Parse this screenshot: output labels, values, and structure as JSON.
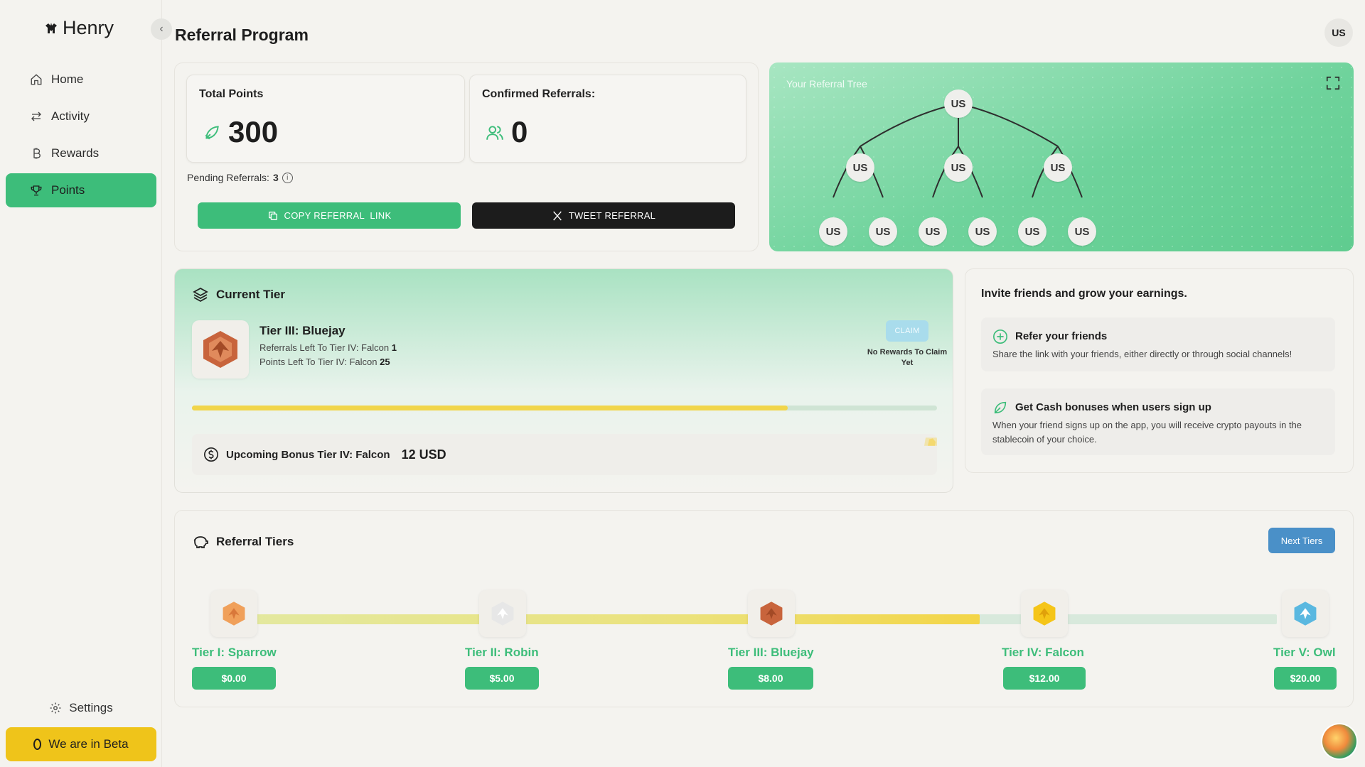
{
  "brand": {
    "name": "Henry"
  },
  "nav": {
    "items": [
      {
        "label": "Home",
        "icon": "home-icon"
      },
      {
        "label": "Activity",
        "icon": "activity-icon"
      },
      {
        "label": "Rewards",
        "icon": "bitcoin-icon"
      },
      {
        "label": "Points",
        "icon": "trophy-icon",
        "active": true
      }
    ],
    "settings_label": "Settings",
    "beta_label": "We are in Beta"
  },
  "header": {
    "title": "Referral Program",
    "user_initials": "US"
  },
  "stats": {
    "total_points_label": "Total Points",
    "total_points_value": "300",
    "confirmed_label": "Confirmed Referrals:",
    "confirmed_value": "0",
    "pending_label": "Pending Referrals:",
    "pending_value": "3",
    "copy_button": "COPY REFERRAL  LINK",
    "tweet_button": "TWEET REFERRAL"
  },
  "tree": {
    "label": "Your Referral Tree",
    "root": "US",
    "level1": [
      "US",
      "US",
      "US"
    ],
    "level2": [
      "US",
      "US",
      "US",
      "US",
      "US",
      "US"
    ]
  },
  "current_tier": {
    "heading": "Current Tier",
    "name": "Tier III: Bluejay",
    "referrals_left_label": "Referrals Left To Tier IV: Falcon",
    "referrals_left_value": "1",
    "points_left_label": "Points Left To Tier IV: Falcon",
    "points_left_value": "25",
    "claim_label": "CLAIM",
    "no_rewards": "No Rewards To Claim Yet",
    "progress_fraction": 0.8,
    "bonus_label": "Upcoming Bonus Tier IV: Falcon",
    "bonus_value": "12 USD"
  },
  "invite": {
    "title": "Invite friends and grow your earnings.",
    "cards": [
      {
        "heading": "Refer your friends",
        "desc": "Share the link with your friends, either directly or through social channels!"
      },
      {
        "heading": "Get Cash bonuses when users sign up",
        "desc": "When your friend signs up on the app, you will receive crypto payouts in the stablecoin of your choice."
      }
    ]
  },
  "referral_tiers": {
    "heading": "Referral Tiers",
    "next_button": "Next Tiers",
    "tiers": [
      {
        "name": "Tier I: Sparrow",
        "price": "$0.00",
        "color": "#f0a05a"
      },
      {
        "name": "Tier II: Robin",
        "price": "$5.00",
        "color": "#dcdcdc"
      },
      {
        "name": "Tier III: Bluejay",
        "price": "$8.00",
        "color": "#c8643c"
      },
      {
        "name": "Tier IV: Falcon",
        "price": "$12.00",
        "color": "#f5c518"
      },
      {
        "name": "Tier V: Owl",
        "price": "$20.00",
        "color": "#5ab8e0"
      }
    ]
  },
  "colors": {
    "accent": "#3dbd7a",
    "beta": "#efc41a",
    "progress": "#f1d54a",
    "next_button": "#4a90c8"
  }
}
